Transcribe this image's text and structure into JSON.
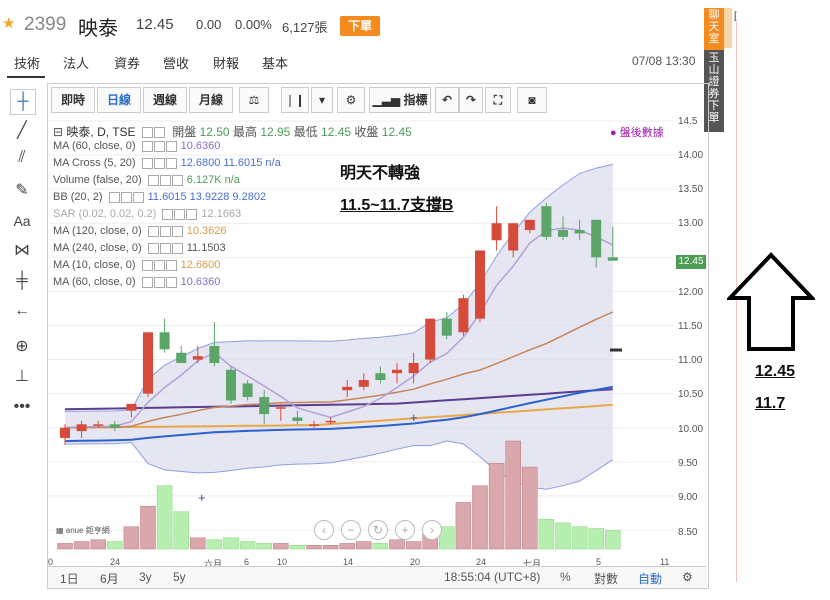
{
  "header": {
    "code": "2399",
    "name": "映泰",
    "price": "12.45",
    "change": "0.00",
    "change_pct": "0.00%",
    "volume": "6,127張",
    "trade_label": "下單"
  },
  "tabs": [
    "技術",
    "法人",
    "資券",
    "營收",
    "財報",
    "基本"
  ],
  "datetime": "07/08 13:30",
  "side_bar": {
    "chat": "聊天室",
    "bank": "玉山證券下單",
    "corner": "["
  },
  "chart_toolbar": {
    "buttons": [
      "即時",
      "日線",
      "週線",
      "月線"
    ],
    "selected": "日線",
    "indicator_label": "指標"
  },
  "legend": {
    "title": "映泰, D, TSE",
    "open_label": "開盤",
    "open": "12.50",
    "high_label": "最高",
    "high": "12.95",
    "low_label": "最低",
    "low": "12.45",
    "close_label": "收盤",
    "close": "12.45",
    "after_hours": "盤後數據",
    "indicators": [
      {
        "name": "MA (60, close, 0)",
        "values": "10.6360"
      },
      {
        "name": "MA Cross (5, 20)",
        "values": "12.6800  11.6015  n/a"
      },
      {
        "name": "Volume (false, 20)",
        "values": "6.127K  n/a"
      },
      {
        "name": "BB (20, 2)",
        "values": "11.6015  13.9228  9.2802"
      },
      {
        "name": "SAR (0.02, 0.02, 0.2)",
        "values": "12.1663"
      },
      {
        "name": "MA (120, close, 0)",
        "values": "10.3626"
      },
      {
        "name": "MA (240, close, 0)",
        "values": "11.1503"
      },
      {
        "name": "MA (10, close, 0)",
        "values": "12.6600"
      },
      {
        "name": "MA (60, close, 0)",
        "values": "10.6360"
      }
    ]
  },
  "annotations": {
    "line1": "明天不轉強",
    "line2": "11.5~11.7支撐B",
    "side_value1": "12.45",
    "side_value2": "11.7"
  },
  "bottom_bar": {
    "ranges": [
      "1日",
      "6月",
      "3y",
      "5y"
    ],
    "time": "18:55:04 (UTC+8)",
    "pct": "%",
    "log": "對數",
    "auto": "自動"
  },
  "chart_data": {
    "type": "candlestick",
    "ylim": [
      8.25,
      14.5
    ],
    "y_ticks": [
      8.5,
      9.0,
      9.5,
      10.0,
      10.5,
      11.0,
      11.5,
      12.0,
      12.5,
      13.0,
      13.5,
      14.0,
      14.5
    ],
    "x_ticks": [
      "0",
      "24",
      "六月",
      "6",
      "10",
      "14",
      "20",
      "24",
      "七月",
      "5",
      "11"
    ],
    "last_price_tag": "12.45",
    "candles": [
      {
        "o": 9.85,
        "h": 10.05,
        "l": 9.75,
        "c": 10.0
      },
      {
        "o": 9.95,
        "h": 10.1,
        "l": 9.85,
        "c": 10.05
      },
      {
        "o": 10.05,
        "h": 10.1,
        "l": 10.0,
        "c": 10.05
      },
      {
        "o": 10.05,
        "h": 10.1,
        "l": 9.95,
        "c": 10.0
      },
      {
        "o": 10.25,
        "h": 10.3,
        "l": 10.15,
        "c": 10.35
      },
      {
        "o": 10.5,
        "h": 11.25,
        "l": 10.45,
        "c": 11.4
      },
      {
        "o": 11.4,
        "h": 11.6,
        "l": 11.1,
        "c": 11.15
      },
      {
        "o": 11.1,
        "h": 11.2,
        "l": 10.95,
        "c": 10.95
      },
      {
        "o": 11.0,
        "h": 11.2,
        "l": 10.95,
        "c": 11.05
      },
      {
        "o": 11.2,
        "h": 11.55,
        "l": 10.9,
        "c": 10.95
      },
      {
        "o": 10.85,
        "h": 10.9,
        "l": 10.35,
        "c": 10.4
      },
      {
        "o": 10.65,
        "h": 10.7,
        "l": 10.4,
        "c": 10.45
      },
      {
        "o": 10.45,
        "h": 10.55,
        "l": 10.05,
        "c": 10.2
      },
      {
        "o": 10.3,
        "h": 10.35,
        "l": 10.1,
        "c": 10.3
      },
      {
        "o": 10.15,
        "h": 10.25,
        "l": 10.05,
        "c": 10.1
      },
      {
        "o": 10.05,
        "h": 10.1,
        "l": 10.0,
        "c": 10.05
      },
      {
        "o": 10.1,
        "h": 10.15,
        "l": 10.05,
        "c": 10.1
      },
      {
        "o": 10.55,
        "h": 10.7,
        "l": 10.45,
        "c": 10.6
      },
      {
        "o": 10.6,
        "h": 10.8,
        "l": 10.55,
        "c": 10.7
      },
      {
        "o": 10.8,
        "h": 10.9,
        "l": 10.65,
        "c": 10.7
      },
      {
        "o": 10.8,
        "h": 10.95,
        "l": 10.65,
        "c": 10.85
      },
      {
        "o": 10.8,
        "h": 11.1,
        "l": 10.65,
        "c": 10.95
      },
      {
        "o": 11.0,
        "h": 11.45,
        "l": 10.95,
        "c": 11.6
      },
      {
        "o": 11.6,
        "h": 11.7,
        "l": 11.3,
        "c": 11.35
      },
      {
        "o": 11.4,
        "h": 11.95,
        "l": 11.35,
        "c": 11.9
      },
      {
        "o": 11.6,
        "h": 11.65,
        "l": 11.55,
        "c": 12.6
      },
      {
        "o": 12.75,
        "h": 13.25,
        "l": 12.6,
        "c": 13.0
      },
      {
        "o": 12.6,
        "h": 13.0,
        "l": 12.5,
        "c": 13.0
      },
      {
        "o": 12.9,
        "h": 13.05,
        "l": 12.85,
        "c": 13.05
      },
      {
        "o": 13.25,
        "h": 13.3,
        "l": 12.75,
        "c": 12.8
      },
      {
        "o": 12.9,
        "h": 13.1,
        "l": 12.75,
        "c": 12.8
      },
      {
        "o": 12.9,
        "h": 13.05,
        "l": 12.75,
        "c": 12.85
      },
      {
        "o": 13.05,
        "h": 13.05,
        "l": 12.35,
        "c": 12.5
      },
      {
        "o": 12.5,
        "h": 12.95,
        "l": 12.45,
        "c": 12.45
      }
    ],
    "volume": [
      0.3,
      0.4,
      0.5,
      0.4,
      1.2,
      2.3,
      3.4,
      2.0,
      0.6,
      0.5,
      0.6,
      0.4,
      0.3,
      0.3,
      0.2,
      0.2,
      0.2,
      0.3,
      0.4,
      0.3,
      0.5,
      0.4,
      0.8,
      1.2,
      2.5,
      3.4,
      4.6,
      5.8,
      4.4,
      1.6,
      1.4,
      1.2,
      1.1,
      1.0
    ]
  }
}
